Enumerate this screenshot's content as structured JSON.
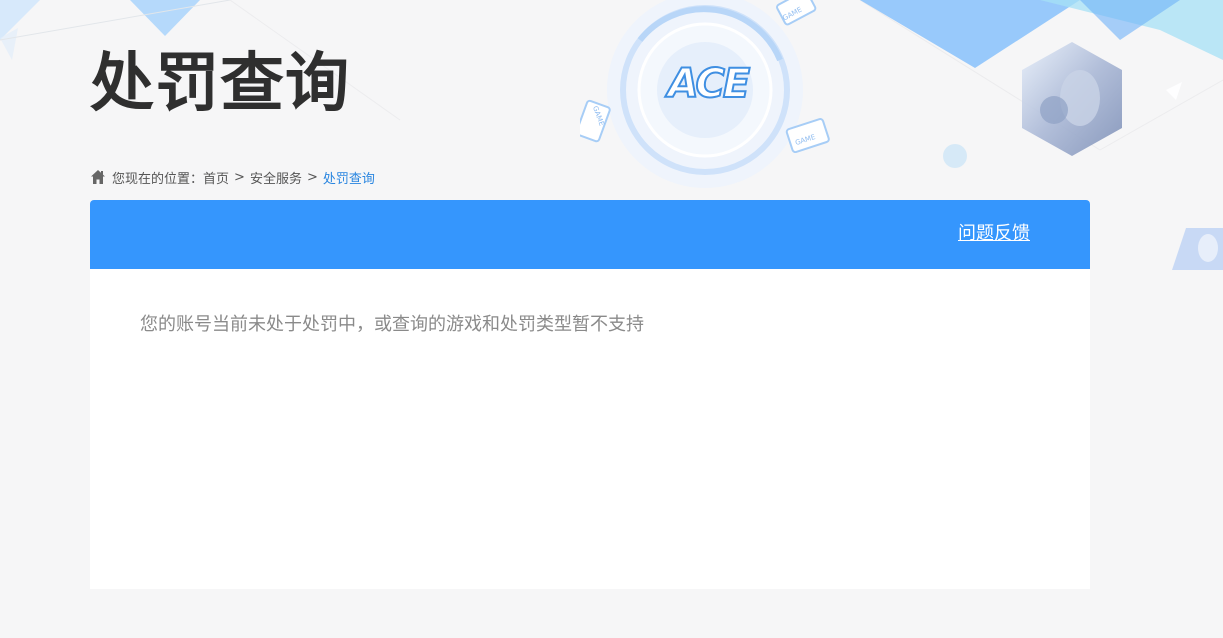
{
  "header": {
    "title": "处罚查询",
    "logo_text": "ACE",
    "game_badges": [
      "GAME",
      "GAME",
      "GAME"
    ]
  },
  "breadcrumb": {
    "prefix": "您现在的位置：",
    "items": [
      "首页",
      "安全服务",
      "处罚查询"
    ],
    "separator": ">"
  },
  "panel": {
    "feedback_label": "问题反馈",
    "message": "您的账号当前未处于处罚中，或查询的游戏和处罚类型暂不支持"
  },
  "colors": {
    "accent": "#3596fd",
    "breadcrumb_current": "#2a86e0",
    "title": "#2f2f2f",
    "message": "#8a8a8a"
  }
}
